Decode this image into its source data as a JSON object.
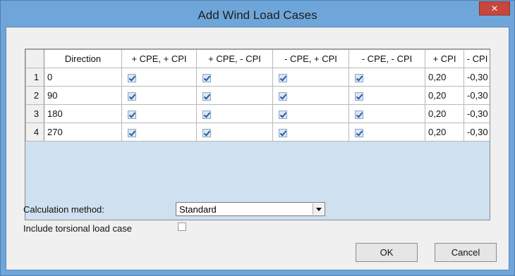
{
  "window": {
    "title": "Add Wind Load Cases",
    "close_glyph": "×"
  },
  "grid": {
    "columns": [
      "Direction",
      "+ CPE, + CPI",
      "+ CPE, - CPI",
      "- CPE, + CPI",
      "- CPE, - CPI",
      "+ CPI",
      "- CPI"
    ],
    "rows": [
      {
        "num": "1",
        "direction": "0",
        "c1": true,
        "c2": true,
        "c3": true,
        "c4": true,
        "cpi_pos": "0,20",
        "cpi_neg": "-0,30"
      },
      {
        "num": "2",
        "direction": "90",
        "c1": true,
        "c2": true,
        "c3": true,
        "c4": true,
        "cpi_pos": "0,20",
        "cpi_neg": "-0,30"
      },
      {
        "num": "3",
        "direction": "180",
        "c1": true,
        "c2": true,
        "c3": true,
        "c4": true,
        "cpi_pos": "0,20",
        "cpi_neg": "-0,30"
      },
      {
        "num": "4",
        "direction": "270",
        "c1": true,
        "c2": true,
        "c3": true,
        "c4": true,
        "cpi_pos": "0,20",
        "cpi_neg": "-0,30"
      }
    ]
  },
  "options": {
    "calc_method_label": "Calculation method:",
    "calc_method_value": "Standard",
    "torsion_label": "Include torsional load case",
    "torsion_checked": false
  },
  "buttons": {
    "ok": "OK",
    "cancel": "Cancel"
  },
  "colors": {
    "title_bar": "#6fa6da",
    "close_button": "#c7463e",
    "grid_empty_area": "#cfe0f0"
  }
}
